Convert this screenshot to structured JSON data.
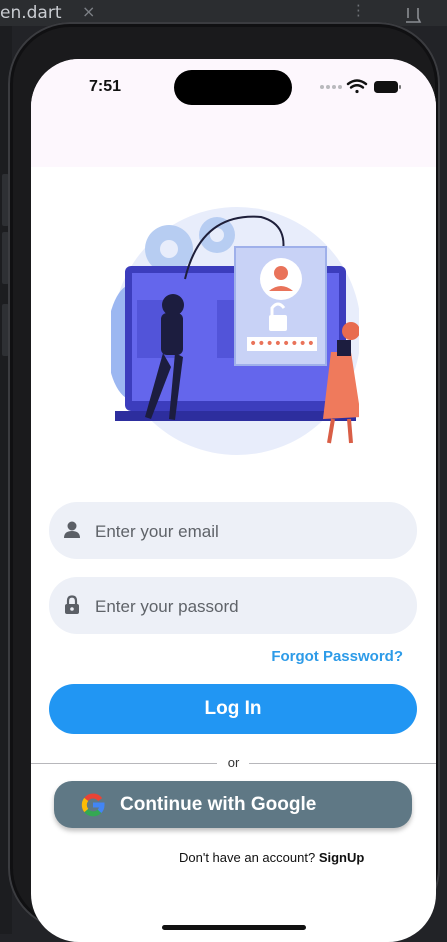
{
  "editor": {
    "tab_label": "en.dart",
    "close_glyph": "×"
  },
  "status_bar": {
    "time": "7:51",
    "icons": [
      "signal-dots-icon",
      "wifi-icon",
      "battery-icon"
    ]
  },
  "illustration": {
    "description_icon": "hacker-login-illustration",
    "password_mask": "••••••••",
    "colors": {
      "laptop": "#5b5ce6",
      "blob": "#dfe6fb",
      "gear": "#a9c3f0",
      "accent": "#e9735a"
    }
  },
  "form": {
    "email": {
      "placeholder": "Enter your email",
      "value": "",
      "icon": "person-icon"
    },
    "password": {
      "placeholder": "Enter your passord",
      "value": "",
      "icon": "lock-icon"
    },
    "forgot_label": "Forgot Password?",
    "login_label": "Log In",
    "or_label": "or",
    "google_label": "Continue with Google",
    "signup_prompt": "Don't have an account?",
    "signup_label": "SignUp"
  },
  "colors": {
    "primary": "#2196f3",
    "link": "#2d9be8",
    "google_button": "#5f7885",
    "field_bg": "#edf0f7",
    "appbar_bg": "#fdf7fd"
  }
}
